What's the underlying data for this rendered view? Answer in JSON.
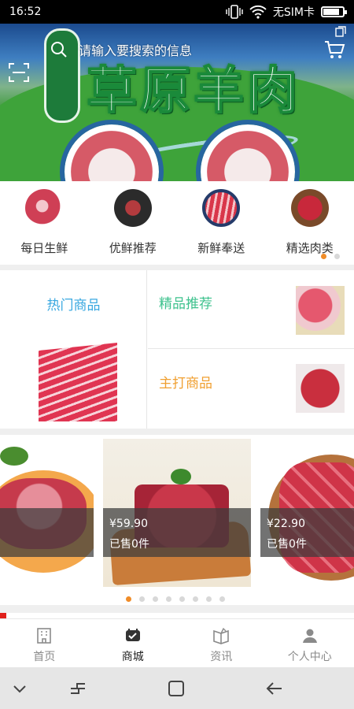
{
  "status_bar": {
    "time": "16:52",
    "carrier": "无SIM卡"
  },
  "banner": {
    "search_placeholder": "请输入要搜索的信息",
    "title": "草原羊肉"
  },
  "categories": [
    {
      "label": "每日生鲜",
      "icon": "meat-thumb"
    },
    {
      "label": "优鲜推荐",
      "icon": "steak-plate-thumb"
    },
    {
      "label": "新鲜奉送",
      "icon": "sliced-meat-thumb"
    },
    {
      "label": "精选肉类",
      "icon": "meat-cubes-thumb"
    }
  ],
  "promo": {
    "hot": "热门商品",
    "featured": "精品推荐",
    "main": "主打商品"
  },
  "products": [
    {
      "price": "",
      "sold": ""
    },
    {
      "price": "¥59.90",
      "sold": "已售0件"
    },
    {
      "price": "¥22.90",
      "sold": "已售0件"
    }
  ],
  "tabs": [
    {
      "label": "首页",
      "icon": "home-icon"
    },
    {
      "label": "商城",
      "icon": "store-icon",
      "active": true
    },
    {
      "label": "资讯",
      "icon": "news-icon"
    },
    {
      "label": "个人中心",
      "icon": "profile-icon"
    }
  ],
  "colors": {
    "hot": "#3aa8e0",
    "featured": "#3ec28e",
    "main": "#f0a032",
    "accent_dot": "#f08c28"
  }
}
